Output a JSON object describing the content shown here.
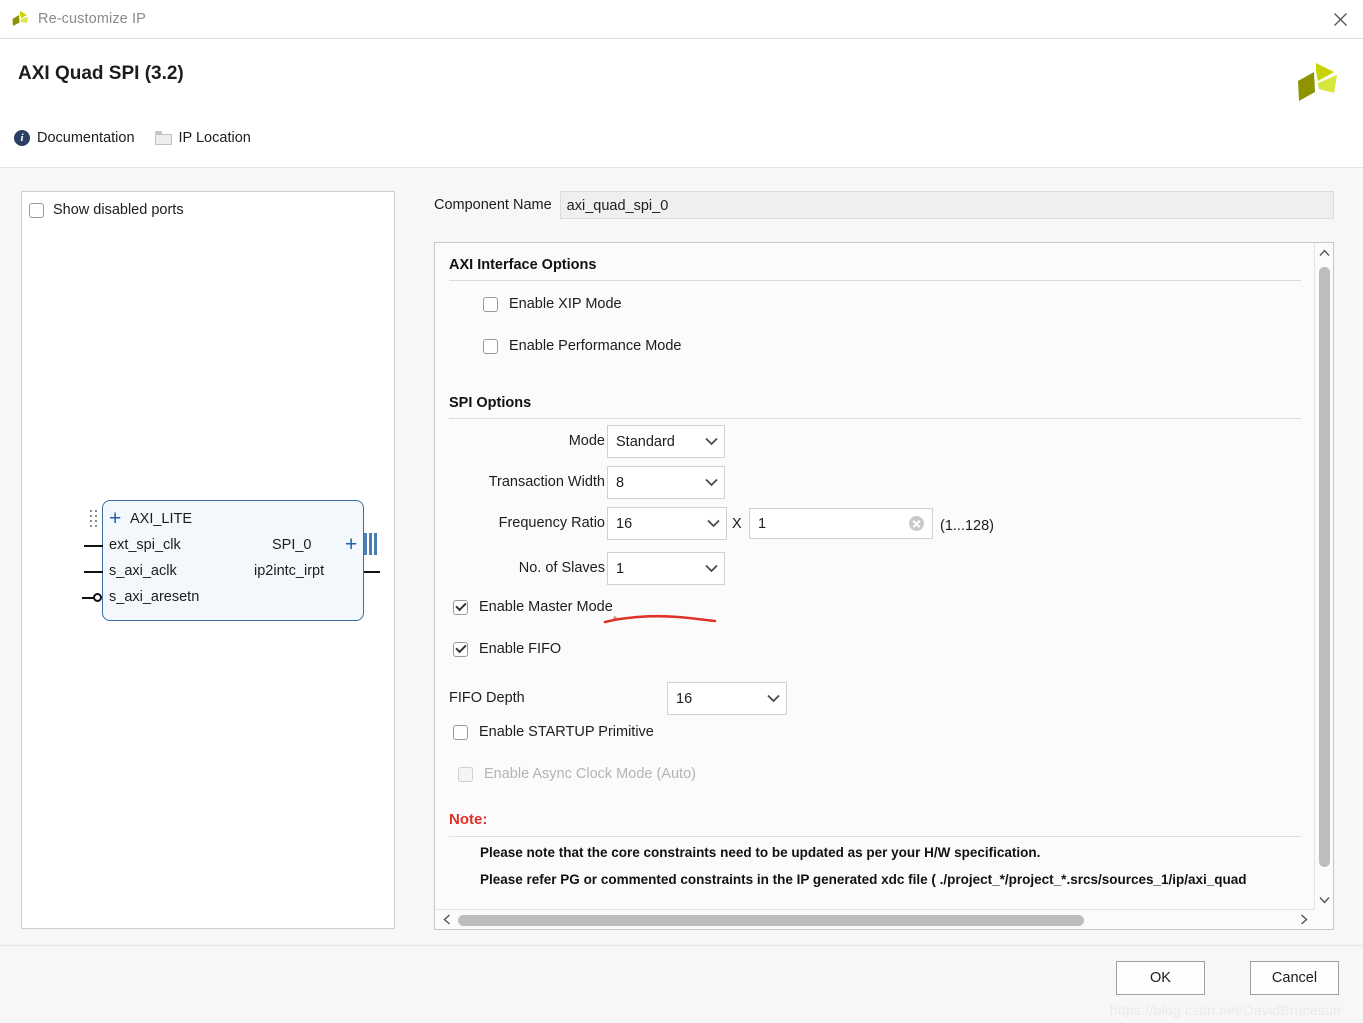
{
  "window": {
    "title": "Re-customize IP",
    "close_icon": "close-icon",
    "logo_icon": "xilinx-logo-icon"
  },
  "header": {
    "ip_title": "AXI Quad SPI (3.2)",
    "links": [
      {
        "label": "Documentation",
        "icon": "info-icon"
      },
      {
        "label": "IP Location",
        "icon": "folder-icon"
      }
    ]
  },
  "diagram_panel": {
    "show_disabled_ports": {
      "label": "Show disabled ports",
      "checked": false
    },
    "block": {
      "left_ports": [
        {
          "label": "AXI_LITE",
          "kind": "bus-expandable"
        },
        {
          "label": "ext_spi_clk",
          "kind": "pin"
        },
        {
          "label": "s_axi_aclk",
          "kind": "pin"
        },
        {
          "label": "s_axi_aresetn",
          "kind": "pin-inverted"
        }
      ],
      "right_ports": [
        {
          "label": "SPI_0",
          "kind": "bus-expandable"
        },
        {
          "label": "ip2intc_irpt",
          "kind": "pin"
        }
      ]
    }
  },
  "form": {
    "component_name": {
      "label": "Component Name",
      "value": "axi_quad_spi_0"
    },
    "sections": [
      {
        "title": "AXI Interface Options"
      },
      {
        "title": "SPI Options"
      }
    ],
    "axi_options": [
      {
        "label": "Enable XIP Mode",
        "checked": false,
        "disabled": false
      },
      {
        "label": "Enable Performance Mode",
        "checked": false,
        "disabled": false
      }
    ],
    "spi_fields": [
      {
        "label": "Mode",
        "value": "Standard"
      },
      {
        "label": "Transaction Width",
        "value": "8"
      },
      {
        "label": "Frequency Ratio",
        "value": "16"
      },
      {
        "label": "No. of Slaves",
        "value": "1"
      }
    ],
    "freq_multiplier": {
      "x_label": "X",
      "value": "1",
      "hint": "(1...128)",
      "clear_icon": "clear-icon"
    },
    "spi_checkboxes": [
      {
        "label": "Enable Master Mode",
        "checked": true,
        "disabled": false
      },
      {
        "label": "Enable FIFO",
        "checked": true,
        "disabled": false
      }
    ],
    "fifo_depth": {
      "label": "FIFO Depth",
      "value": "16"
    },
    "trailing_checkboxes": [
      {
        "label": "Enable STARTUP Primitive",
        "checked": false,
        "disabled": false
      },
      {
        "label": "Enable Async Clock Mode (Auto)",
        "checked": false,
        "disabled": true
      }
    ],
    "note": {
      "title": "Note:",
      "lines": [
        "Please note that the core constraints need to be updated as per your H/W specification.",
        "Please refer PG or commented constraints in the IP generated xdc file ( ./project_*/project_*.srcs/sources_1/ip/axi_quad"
      ]
    }
  },
  "footer": {
    "ok_label": "OK",
    "cancel_label": "Cancel",
    "watermark": "https://blog.csdn.net/DavidBrucesun"
  },
  "colors": {
    "accent_red": "#e03127",
    "logo_green": "#c8d400",
    "block_border": "#3a6ea5",
    "info_blue": "#2b3f63"
  }
}
